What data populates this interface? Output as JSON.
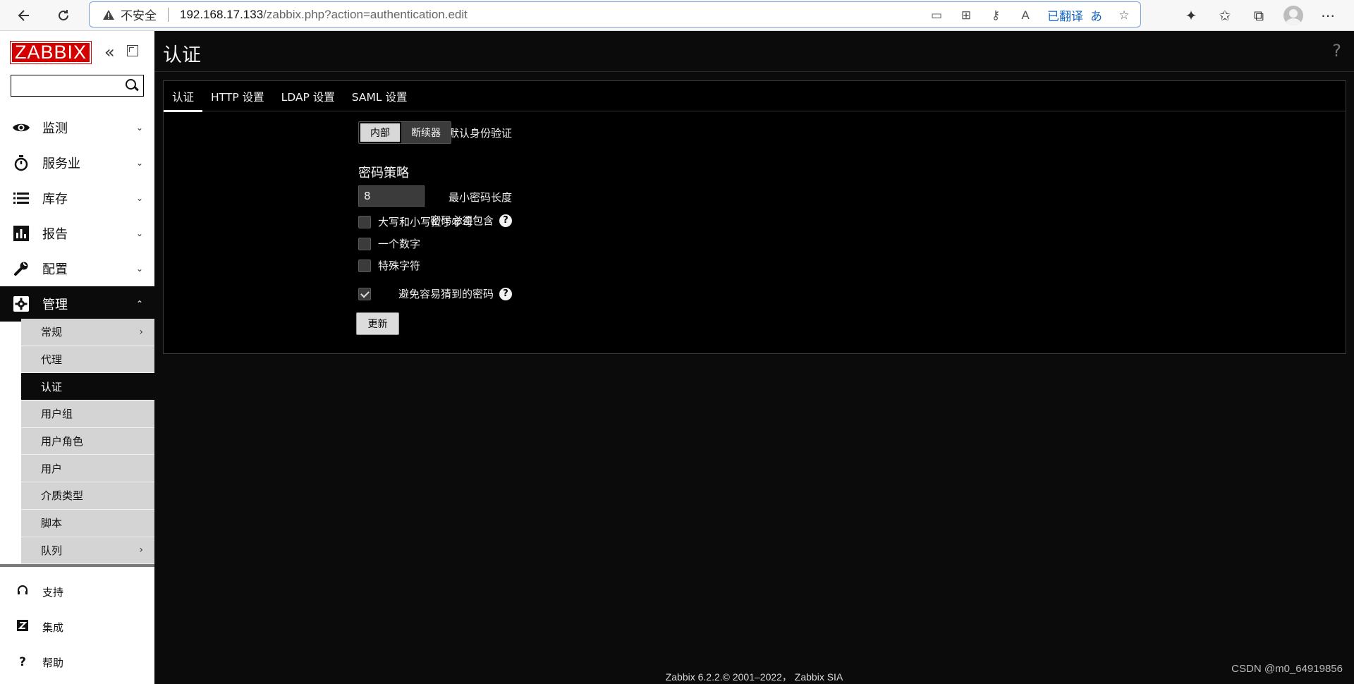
{
  "browser": {
    "security_label": "不安全",
    "url_host": "192.168.17.133",
    "url_path": "/zabbix.php?action=authentication.edit",
    "translate_label": "已翻译"
  },
  "sidebar": {
    "logo": "ZABBIX",
    "search_value": "",
    "items": [
      {
        "label": "监测",
        "icon": "eye-icon"
      },
      {
        "label": "服务业",
        "icon": "stopwatch-icon"
      },
      {
        "label": "库存",
        "icon": "list-icon"
      },
      {
        "label": "报告",
        "icon": "bar-chart-icon"
      },
      {
        "label": "配置",
        "icon": "wrench-icon"
      },
      {
        "label": "管理",
        "icon": "gear-icon"
      }
    ],
    "submenu": [
      {
        "label": "常规"
      },
      {
        "label": "代理"
      },
      {
        "label": "认证"
      },
      {
        "label": "用户组"
      },
      {
        "label": "用户角色"
      },
      {
        "label": "用户"
      },
      {
        "label": "介质类型"
      },
      {
        "label": "脚本"
      },
      {
        "label": "队列"
      }
    ],
    "bottom": [
      {
        "label": "支持",
        "icon": "headset-icon"
      },
      {
        "label": "集成",
        "icon": "zabbix-z-icon"
      },
      {
        "label": "帮助",
        "icon": "question-icon"
      }
    ]
  },
  "main": {
    "title": "认证",
    "tabs": [
      "认证",
      "HTTP 设置",
      "LDAP 设置",
      "SAML 设置"
    ],
    "form": {
      "default_auth_label": "默认身份验证",
      "auth_options": [
        "内部",
        "断续器"
      ],
      "auth_selected": "内部",
      "password_policy_title": "密码策略",
      "min_length_label": "最小密码长度",
      "min_length_value": "8",
      "must_contain_label": "密码必须包含",
      "contain_options": [
        {
          "label": "大写和小写拉丁字母",
          "checked": false
        },
        {
          "label": "一个数字",
          "checked": false
        },
        {
          "label": "特殊字符",
          "checked": false
        }
      ],
      "avoid_easy_label": "避免容易猜到的密码",
      "avoid_easy_checked": true,
      "update_button": "更新"
    },
    "footer": "Zabbix 6.2.2.© 2001–2022， Zabbix SIA",
    "watermark": "CSDN @m0_64919856"
  }
}
